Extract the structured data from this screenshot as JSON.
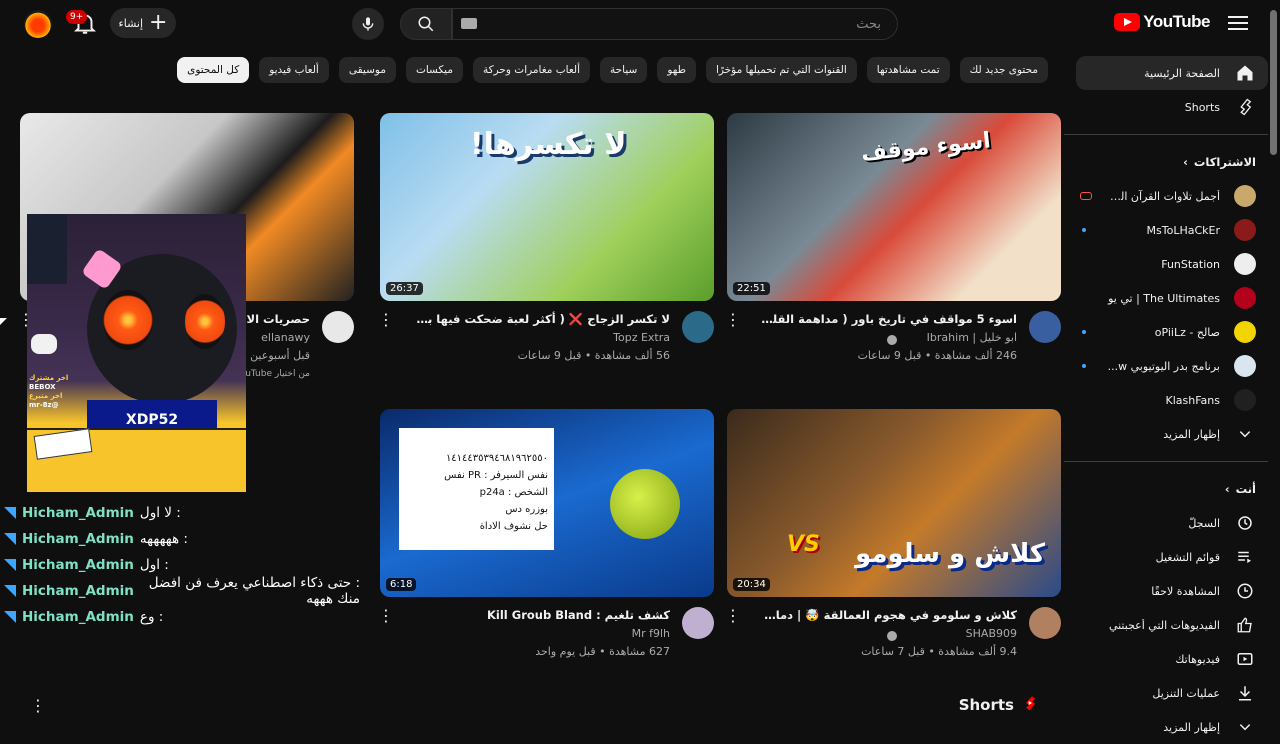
{
  "header": {
    "logo_text": "YouTube",
    "search_placeholder": "بحث",
    "create_label": "إنشاء",
    "notifications_badge": "9+"
  },
  "chips": [
    "كل المحتوى",
    "ألعاب فيديو",
    "موسيقى",
    "ميكسات",
    "ألعاب مغامرات وحركة",
    "سياحة",
    "طهو",
    "القنوات التي تم تحميلها مؤخرًا",
    "تمت مشاهدتها",
    "محتوى جديد لك"
  ],
  "sidebar": {
    "home": "الصفحة الرئيسية",
    "shorts": "Shorts",
    "subscriptions_title": "الاشتراكات",
    "subscriptions": [
      {
        "label": "أجمل تلاوات القرآن الكر...",
        "color": "#c8a86b",
        "status": "live"
      },
      {
        "label": "MsToLHaCkEr",
        "color": "#8b1a1a",
        "status": "dot"
      },
      {
        "label": "FunStation",
        "color": "#eeeeee",
        "status": ""
      },
      {
        "label": "The Ultimates | تي يو",
        "color": "#b3001b",
        "status": ""
      },
      {
        "label": "صالح - oPiiLz",
        "color": "#f2d400",
        "status": "dot"
      },
      {
        "label": "برنامج بدر اليوتيوبي w...",
        "color": "#d9e6ef",
        "status": "dot"
      },
      {
        "label": "KlashFans",
        "color": "#202020",
        "status": ""
      }
    ],
    "show_more": "إظهار المزيد",
    "you_title": "أنت",
    "you_items": [
      "السجلّ",
      "قوائم التشغيل",
      "المشاهدة لاحقًا",
      "الفيديوهات التي أعجبتني",
      "فيديوهاتك",
      "عمليات التنزيل",
      "إظهار المزيد"
    ]
  },
  "videos": [
    {
      "title": "اسوء 5 مواقف في تاريخ باور ( مداهمة القلة !!)",
      "channel": "ابو خليل | Ibrahim",
      "stats": "246 ألف مشاهدة • قبل 9 ساعات",
      "duration": "22:51",
      "thumb_bg": "linear-gradient(135deg,#2d3a44,#7a8a95 40%,#d94a3a 55%,#f2e0c8 80%)",
      "avatar_color": "#3a5fa0",
      "verified": true
    },
    {
      "title": "لا تكسر الزجاج ❌ ( أكثر لعبة ضحكت فيها بحياتي 🤣 )",
      "channel": "Topz Extra",
      "stats": "56 ألف مشاهدة • قبل 9 ساعات",
      "duration": "26:37",
      "thumb_bg": "linear-gradient(135deg,#7fc0e8,#b9dcf2 35%,#9fcf5a 70%,#5a9e2b)",
      "avatar_color": "#2c6a8a",
      "verified": false
    },
    {
      "title": "حصريات الانتس",
      "channel": "ellanawy",
      "stats": "قبل أسبوعين",
      "extra": "من اختيار YouTube",
      "duration": "",
      "thumb_bg": "linear-gradient(135deg,#e9e9e9,#c7c7c7 40%,#1c1c1c 60%,#f08a24 70%,#222)",
      "avatar_color": "#e8e8e8",
      "verified": false
    },
    {
      "title": "كلاش و سلومو في هجوم العمالقة 🤯 | دمات رمبكت",
      "channel": "SHAB909",
      "stats": "9.4 ألف مشاهدة • قبل 7 ساعات",
      "duration": "20:34",
      "thumb_bg": "linear-gradient(135deg,#3a2a1c,#8a5a2c 40%,#c47a2a 60%,#2a4a8a)",
      "avatar_color": "#b08060",
      "verified": true
    },
    {
      "title": "كشف تلغيم : Kill Groub Bland",
      "channel": "Mr f9lh",
      "stats": "627 مشاهدة • قبل يوم واحد",
      "duration": "6:18",
      "thumb_bg": "linear-gradient(160deg,#0a2a6a,#1a6ad0 50%,#0a3a8a)",
      "avatar_color": "#c0b0d0",
      "verified": false,
      "note_lines": [
        "١٤١٤٤٣٥٣٩٤٦٨١٩٦٢٥٥٠",
        "نفس السيرفر : PR نفس",
        "الشخص : p24a",
        "بوزره دس",
        "حل نشوف الاداة"
      ]
    }
  ],
  "thumb_text": {
    "v1": "اسوء موقف",
    "v2": "لا تكسرها!",
    "v4": "كلاش و سلومو"
  },
  "chat": [
    {
      "user": "Hicham_Admin",
      "msg": ": لا اول"
    },
    {
      "user": "Hicham_Admin",
      "msg": ": هههههه"
    },
    {
      "user": "Hicham_Admin",
      "msg": ": اول"
    },
    {
      "user": "Hicham_Admin",
      "msg": ": حتى ذكاء اصطناعي يعرف فن افضل منك هههه"
    },
    {
      "user": "Hicham_Admin",
      "msg": ": وع"
    }
  ],
  "stream_overlay": {
    "line1": "اخر مشترك",
    "line2": "BEBOX",
    "line3": "اخر متبرع",
    "line4": "@mr-8z",
    "jersey": "XDP52"
  },
  "shorts_section": "Shorts",
  "colors": {
    "bg": "#0f0f0f",
    "chip": "#272727",
    "accent": "#ff0000",
    "chat_user": "#7fe0c6"
  }
}
